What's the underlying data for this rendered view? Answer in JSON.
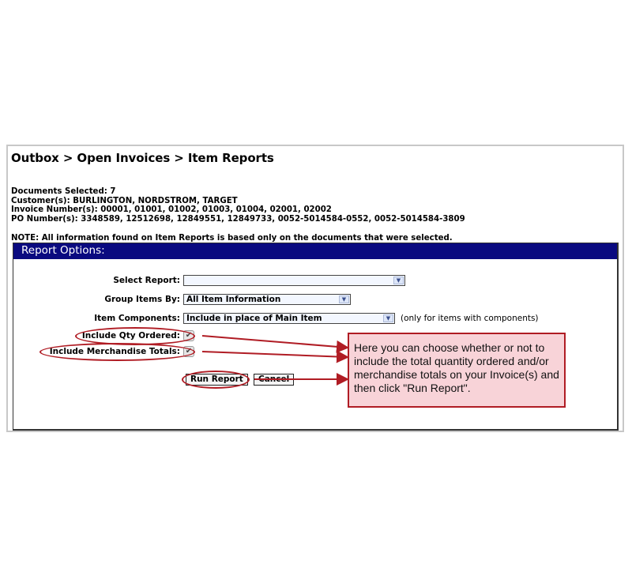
{
  "breadcrumb": "Outbox > Open Invoices > Item Reports",
  "info": {
    "documents_selected": "Documents Selected: 7",
    "customers": "Customer(s): BURLINGTON, NORDSTROM, TARGET",
    "invoice_numbers": "Invoice Number(s): 00001, 01001, 01002, 01003, 01004, 02001, 02002",
    "po_numbers": "PO Number(s): 3348589, 12512698, 12849551, 12849733, 0052-5014584-0552, 0052-5014584-3809"
  },
  "note": "NOTE: All information found on Item Reports is based only on the documents that were selected.",
  "panel": {
    "header": "Report Options:",
    "select_report": {
      "label": "Select Report:",
      "value": ""
    },
    "group_items_by": {
      "label": "Group Items By:",
      "value": "All Item Information"
    },
    "item_components": {
      "label": "Item Components:",
      "value": "Include in place of Main Item",
      "hint": "(only for items with components)"
    },
    "include_qty_ordered": {
      "label": "Include Qty Ordered:",
      "checked": true,
      "glyph": "✔"
    },
    "include_merch_totals": {
      "label": "Include Merchandise Totals:",
      "checked": true,
      "glyph": "✔"
    },
    "run_report_label": "Run Report",
    "cancel_label": "Cancel"
  },
  "callout": {
    "text": "Here you can choose whether or not to include the total quantity ordered and/or merchandise totals on your Invoice(s) and then click \"Run Report\".",
    "color": "#b01c24",
    "background": "#f8d3d8"
  },
  "icons": {
    "dropdown_arrow": "⌄"
  }
}
